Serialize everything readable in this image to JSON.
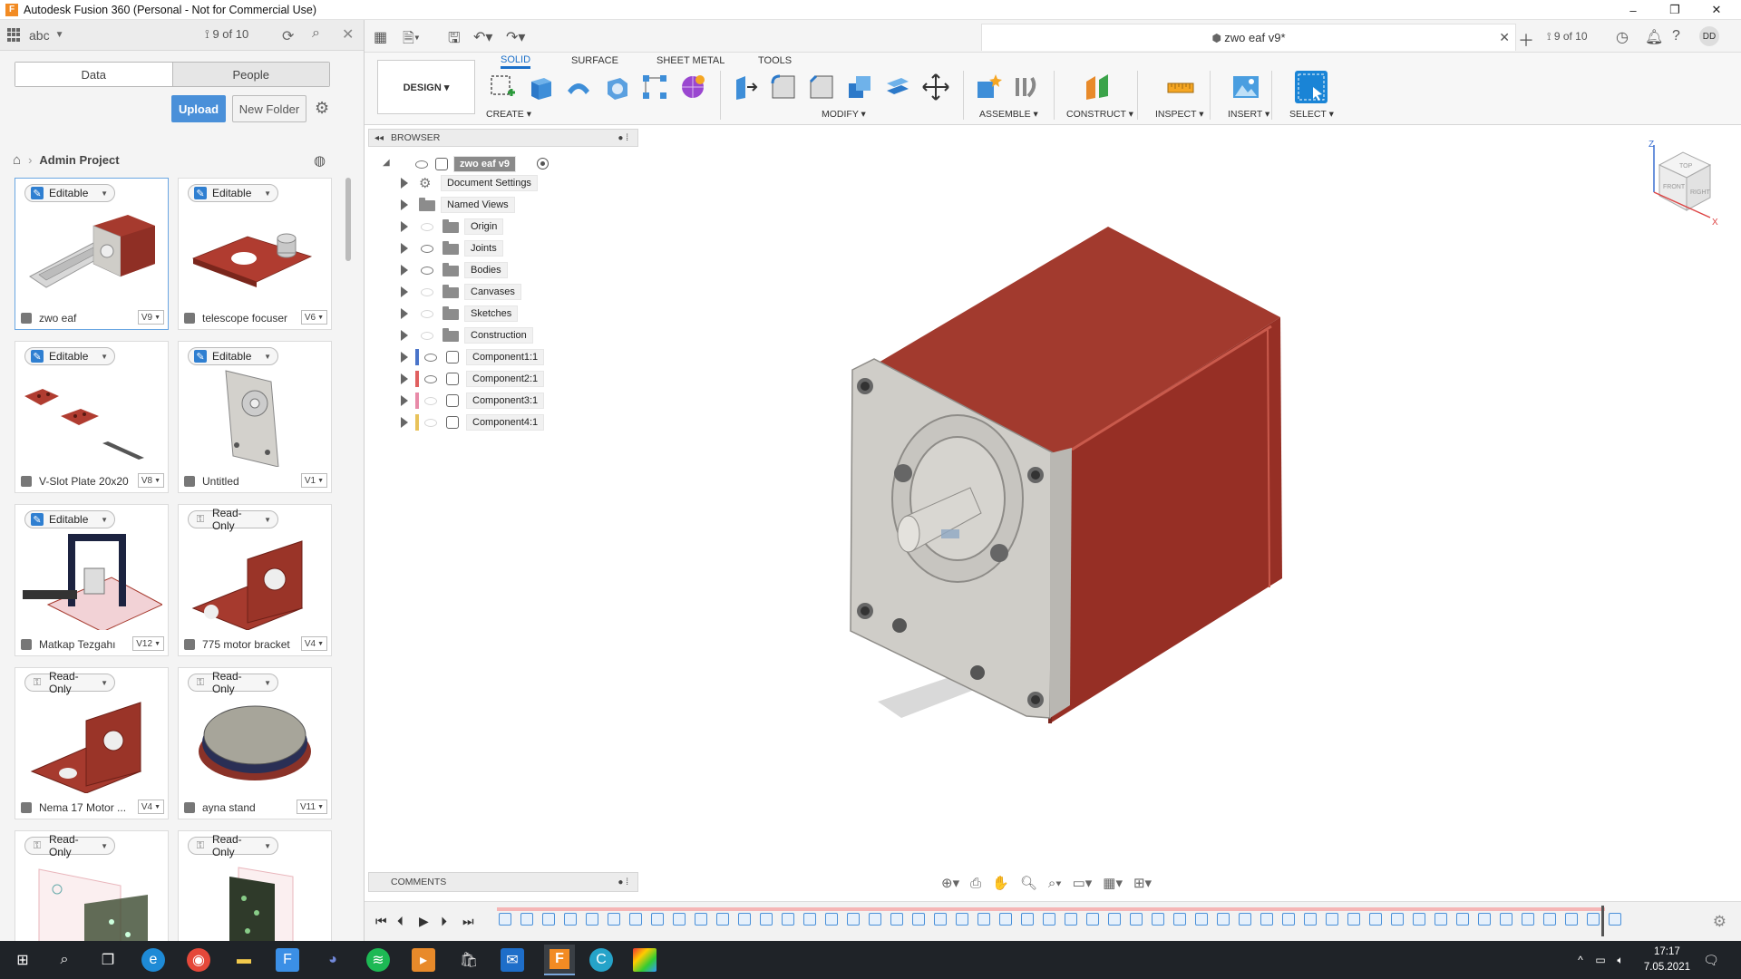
{
  "window": {
    "title": "Autodesk Fusion 360 (Personal - Not for Commercial Use)",
    "minimize": "–",
    "restore": "❐",
    "close": "✕"
  },
  "data_panel": {
    "team": "abc",
    "version_counter": "9 of 10",
    "tabs": [
      "Data",
      "People"
    ],
    "upload": "Upload",
    "new_folder": "New Folder",
    "breadcrumb": "Admin Project",
    "cards": [
      {
        "status": "Editable",
        "name": "zwo eaf",
        "version": "V9"
      },
      {
        "status": "Editable",
        "name": "telescope focuser",
        "version": "V6"
      },
      {
        "status": "Editable",
        "name": "V-Slot Plate 20x20",
        "version": "V8"
      },
      {
        "status": "Editable",
        "name": "Untitled",
        "version": "V1"
      },
      {
        "status": "Editable",
        "name": "Matkap Tezgahı",
        "version": "V12"
      },
      {
        "status": "Read-Only",
        "name": "775 motor bracket",
        "version": "V4"
      },
      {
        "status": "Read-Only",
        "name": "Nema 17 Motor ...",
        "version": "V4"
      },
      {
        "status": "Read-Only",
        "name": "ayna stand",
        "version": "V11"
      },
      {
        "status": "Read-Only",
        "name": "",
        "version": ""
      },
      {
        "status": "Read-Only",
        "name": "",
        "version": ""
      }
    ]
  },
  "document": {
    "tab_name": "zwo eaf v9*",
    "version_counter": "9 of 10",
    "user_initials": "DD"
  },
  "ribbon": {
    "workspace": "DESIGN ▾",
    "tabs": [
      "SOLID",
      "SURFACE",
      "SHEET METAL",
      "TOOLS"
    ],
    "groups": [
      "CREATE ▾",
      "MODIFY ▾",
      "ASSEMBLE ▾",
      "CONSTRUCT ▾",
      "INSPECT ▾",
      "INSERT ▾",
      "SELECT ▾"
    ]
  },
  "browser": {
    "title": "BROWSER",
    "root": "zwo eaf v9",
    "items": [
      "Document Settings",
      "Named Views",
      "Origin",
      "Joints",
      "Bodies",
      "Canvases",
      "Sketches",
      "Construction",
      "Component1:1",
      "Component2:1",
      "Component3:1",
      "Component4:1"
    ],
    "component_colors": [
      "#4a74c9",
      "#e06060",
      "#e88aa8",
      "#e8c25a"
    ]
  },
  "viewcube": {
    "top": "TOP",
    "front": "FRONT",
    "right": "RIGHT",
    "axis_z": "Z",
    "axis_x": "X"
  },
  "comments": {
    "title": "COMMENTS"
  },
  "taskbar": {
    "time": "17:17",
    "date": "7.05.2021"
  },
  "colors": {
    "accent": "#1a6fc9",
    "motor_red": "#a63a2e",
    "plate_gray": "#cfcdc8"
  }
}
